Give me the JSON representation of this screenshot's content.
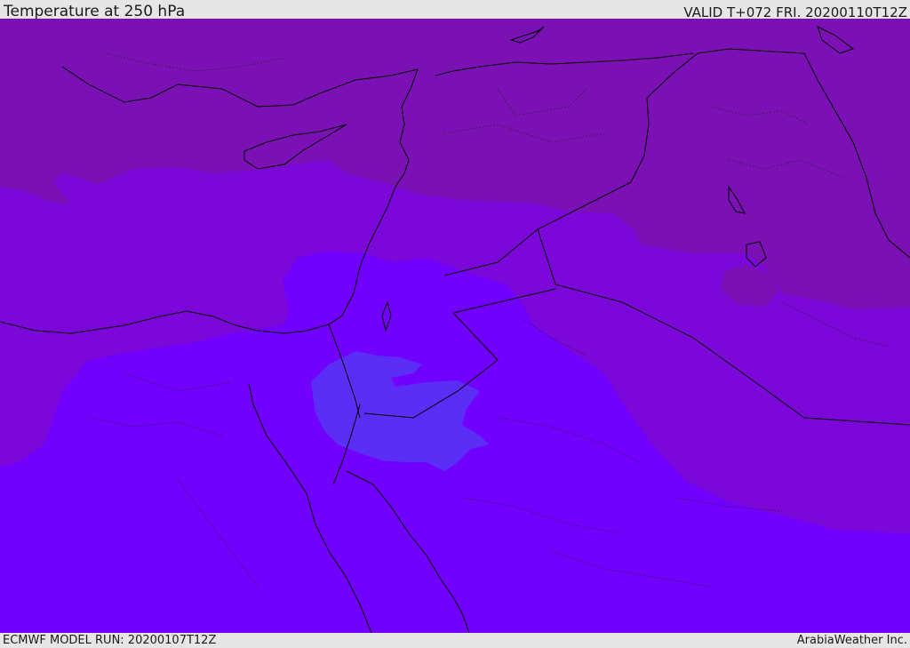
{
  "header": {
    "title": "Temperature at 250 hPa",
    "valid": "VALID T+072 FRI. 20200110T12Z"
  },
  "footer": {
    "model_run": "ECMWF MODEL RUN: 20200107T12Z",
    "credit": "ArabiaWeather Inc."
  },
  "map": {
    "field": "temperature",
    "level": "250 hPa",
    "colors": {
      "coldest_band": "#5a2ef5",
      "cold_band": "#7200fe",
      "mid_band": "#7b07d9",
      "warm_band": "#7b10b4",
      "background": "#7200fe",
      "coastline": "#000000"
    }
  }
}
